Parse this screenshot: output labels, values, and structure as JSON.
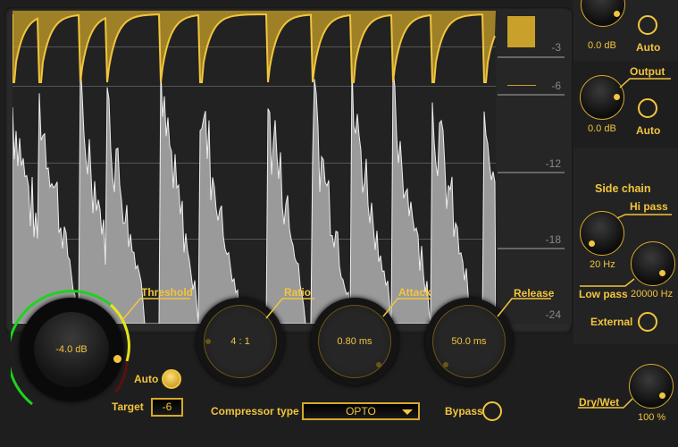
{
  "display": {
    "scale_labels": [
      "-3",
      "-6",
      "-12",
      "-18",
      "-24"
    ],
    "gain_reduction_color": "#c8a02a",
    "waveform_color": "#e8e8e8",
    "envelope_color": "#f2c53d"
  },
  "threshold": {
    "label": "Threshold",
    "value": "-4.0 dB"
  },
  "ratio": {
    "label": "Ratio",
    "value": "4 : 1"
  },
  "attack": {
    "label": "Attack",
    "value": "0.80 ms"
  },
  "release": {
    "label": "Release",
    "value": "50.0 ms"
  },
  "auto": {
    "label": "Auto",
    "on": true
  },
  "target": {
    "label": "Target",
    "value": "-6"
  },
  "compressor_type": {
    "label": "Compressor type",
    "value": "OPTO"
  },
  "bypass": {
    "label": "Bypass"
  },
  "input": {
    "value": "0.0 dB",
    "auto_label": "Auto"
  },
  "output": {
    "label": "Output",
    "value": "0.0 dB",
    "auto_label": "Auto"
  },
  "side_chain": {
    "title": "Side chain",
    "hi_pass": {
      "label": "Hi pass",
      "value": "20 Hz"
    },
    "low_pass": {
      "label": "Low pass",
      "value": "20000 Hz"
    },
    "external": {
      "label": "External"
    }
  },
  "dry_wet": {
    "label": "Dry/Wet",
    "value": "100 %"
  },
  "colors": {
    "accent": "#f2c53d",
    "green": "#1fd21f",
    "yellow": "#e6e61a",
    "red": "#5a1010"
  }
}
